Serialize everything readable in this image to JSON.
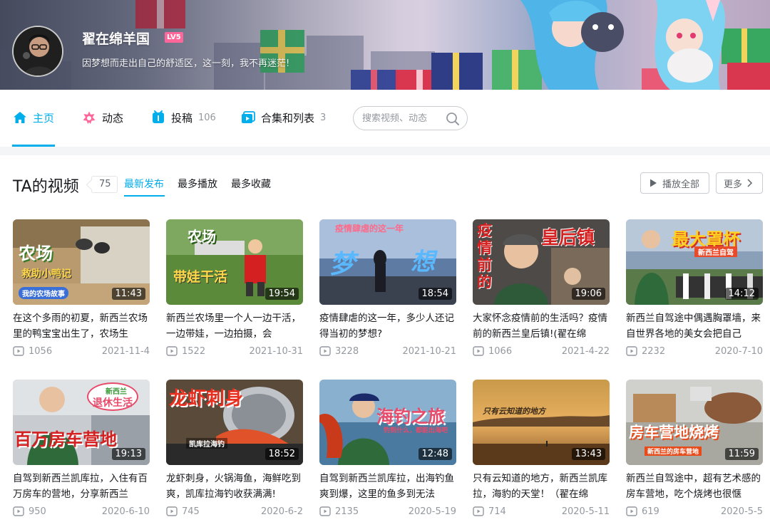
{
  "profile": {
    "name": "翟在绵羊国",
    "level": "LV5",
    "sign": "因梦想而走出自己的舒适区，这一刻，我不再迷茫!"
  },
  "nav": {
    "home": "主页",
    "dynamic": "动态",
    "posts": "投稿",
    "posts_count": "106",
    "collections": "合集和列表",
    "collections_count": "3",
    "search_placeholder": "搜索视频、动态"
  },
  "videos_section": {
    "title": "TA的视频",
    "count": "75",
    "sorts": [
      "最新发布",
      "最多播放",
      "最多收藏"
    ],
    "play_all": "播放全部",
    "more": "更多"
  },
  "videos": [
    {
      "title": "在这个多雨的初夏，新西兰农场里的鸭宝宝出生了，农场生",
      "duration": "11:43",
      "views": "1056",
      "date": "2021-11-4",
      "cover": [
        "农场",
        "救助小鸭记",
        "我的农场故事"
      ]
    },
    {
      "title": "新西兰农场里一个人一边干活，一边带娃，一边拍摄，会",
      "duration": "19:54",
      "views": "1522",
      "date": "2021-10-31",
      "cover": [
        "农场",
        "带娃干活"
      ]
    },
    {
      "title": "疫情肆虐的这一年，多少人还记得当初的梦想?",
      "duration": "18:54",
      "views": "3228",
      "date": "2021-10-21",
      "cover": [
        "疫情肆虐的这一年",
        "梦",
        "想"
      ]
    },
    {
      "title": "大家怀念疫情前的生活吗？疫情前的新西兰皇后镇!(翟在绵",
      "duration": "19:06",
      "views": "1066",
      "date": "2021-4-22",
      "cover": [
        "疫情前的",
        "皇后镇"
      ]
    },
    {
      "title": "新西兰自驾途中偶遇胸罩墙，来自世界各地的美女会把自己",
      "duration": "14:12",
      "views": "2232",
      "date": "2020-7-10",
      "cover": [
        "最大罩杯",
        "新西兰自驾"
      ]
    },
    {
      "title": "自驾到新西兰凯库拉，入住有百万房车的营地，分享新西兰",
      "duration": "19:13",
      "views": "950",
      "date": "2020-6-10",
      "cover": [
        "新西兰",
        "退休生活",
        "百万房车营地"
      ]
    },
    {
      "title": "龙虾刺身，火锅海鱼，海鲜吃到爽，凯库拉海钓收获满满!",
      "duration": "18:52",
      "views": "745",
      "date": "2020-6-2",
      "cover": [
        "龙虾刺身",
        "凯库拉海钓"
      ]
    },
    {
      "title": "自驾到新西兰凯库拉，出海钓鱼爽到爆，这里的鱼多到无法",
      "duration": "12:48",
      "views": "2135",
      "date": "2020-5-19",
      "cover": [
        "海钓之旅",
        "钓到什么，都能出海吧"
      ]
    },
    {
      "title": "只有云知道的地方，新西兰凯库拉，海豹的天堂！（翟在绵",
      "duration": "13:43",
      "views": "714",
      "date": "2020-5-11",
      "cover": [
        "只有云知道的地方"
      ]
    },
    {
      "title": "新西兰自驾途中，超有艺术感的房车营地，吃个烧烤也很惬",
      "duration": "11:59",
      "views": "619",
      "date": "2020-5-5",
      "cover": [
        "房车营地烧烤",
        "新西兰的房车营地"
      ]
    }
  ],
  "colors": {
    "accent": "#00aeec",
    "level_badge": "#ff6699",
    "text_secondary": "#9499a0"
  }
}
